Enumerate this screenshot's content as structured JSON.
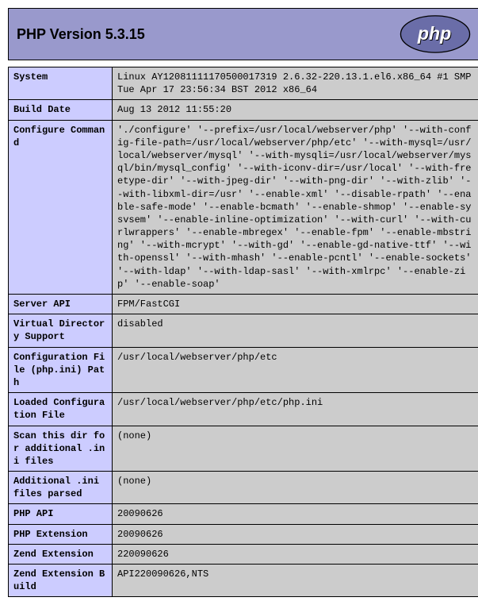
{
  "header": {
    "title": "PHP Version 5.3.15",
    "logo_label": "php"
  },
  "rows": [
    {
      "k": "System",
      "v": "Linux AY12081111170500017319 2.6.32-220.13.1.el6.x86_64 #1 SMP Tue Apr 17 23:56:34 BST 2012 x86_64"
    },
    {
      "k": "Build Date",
      "v": "Aug 13 2012 11:55:20"
    },
    {
      "k": "Configure Command",
      "v": "'./configure' '--prefix=/usr/local/webserver/php' '--with-config-file-path=/usr/local/webserver/php/etc' '--with-mysql=/usr/local/webserver/mysql' '--with-mysqli=/usr/local/webserver/mysql/bin/mysql_config' '--with-iconv-dir=/usr/local' '--with-freetype-dir' '--with-jpeg-dir' '--with-png-dir' '--with-zlib' '--with-libxml-dir=/usr' '--enable-xml' '--disable-rpath' '--enable-safe-mode' '--enable-bcmath' '--enable-shmop' '--enable-sysvsem' '--enable-inline-optimization' '--with-curl' '--with-curlwrappers' '--enable-mbregex' '--enable-fpm' '--enable-mbstring' '--with-mcrypt' '--with-gd' '--enable-gd-native-ttf' '--with-openssl' '--with-mhash' '--enable-pcntl' '--enable-sockets' '--with-ldap' '--with-ldap-sasl' '--with-xmlrpc' '--enable-zip' '--enable-soap'"
    },
    {
      "k": "Server API",
      "v": "FPM/FastCGI"
    },
    {
      "k": "Virtual Directory Support",
      "v": "disabled"
    },
    {
      "k": "Configuration File (php.ini) Path",
      "v": "/usr/local/webserver/php/etc"
    },
    {
      "k": "Loaded Configuration File",
      "v": "/usr/local/webserver/php/etc/php.ini"
    },
    {
      "k": "Scan this dir for additional .ini files",
      "v": "(none)"
    },
    {
      "k": "Additional .ini files parsed",
      "v": "(none)"
    },
    {
      "k": "PHP API",
      "v": "20090626"
    },
    {
      "k": "PHP Extension",
      "v": "20090626"
    },
    {
      "k": "Zend Extension",
      "v": "220090626"
    },
    {
      "k": "Zend Extension Build",
      "v": "API220090626,NTS"
    }
  ]
}
